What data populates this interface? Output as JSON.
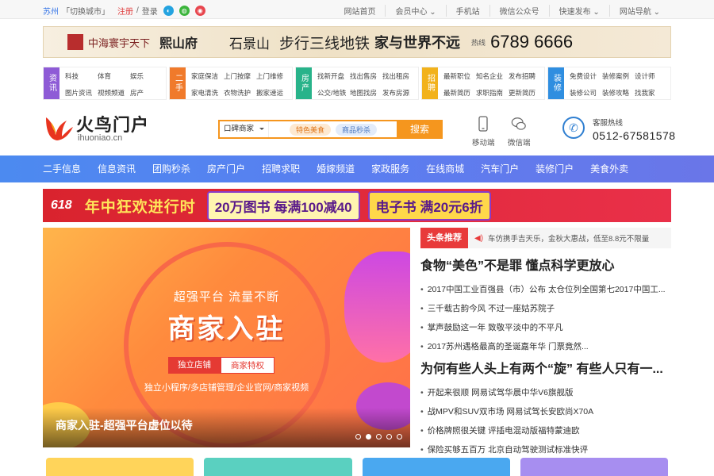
{
  "topbar": {
    "city": "苏州",
    "switch_city": "「切换城市」",
    "register": "注册",
    "sep": "/",
    "login": "登录",
    "links": [
      "网站首页",
      "会员中心 ⌄",
      "手机站",
      "微信公众号",
      "快速发布 ⌄",
      "网站导航 ⌄"
    ]
  },
  "ad_banner": {
    "brand": "中海寰宇天下",
    "project": "熙山府",
    "place": "石景山",
    "slogan_a": "步行三线地铁",
    "slogan_b": "家与世界不远",
    "phone_label": "热线",
    "phone": "6789 6666"
  },
  "categories": [
    {
      "tag": "资讯",
      "color": "#8e5bd6",
      "links": [
        "科技",
        "体育",
        "娱乐",
        "图片资讯",
        "视频频道",
        "房产"
      ]
    },
    {
      "tag": "二手",
      "color": "#f07a2b",
      "links": [
        "家庭保洁",
        "上门按摩",
        "上门维修",
        "家电清洗",
        "衣物洗护",
        "搬家速运"
      ]
    },
    {
      "tag": "房产",
      "color": "#28b38a",
      "links": [
        "找新开盘",
        "找出售房",
        "找出租房",
        "公交/地铁",
        "地图找房",
        "发布房源"
      ]
    },
    {
      "tag": "招聘",
      "color": "#f2b21c",
      "links": [
        "最新职位",
        "知名企业",
        "发布招聘",
        "最新简历",
        "求职指南",
        "更新简历"
      ]
    },
    {
      "tag": "装修",
      "color": "#2f8ee0",
      "links": [
        "免费设计",
        "装修案例",
        "设计师",
        "装修公司",
        "装修攻略",
        "找我家"
      ]
    }
  ],
  "logo": {
    "name": "火鸟门户",
    "domain": "ihuoniao.cn"
  },
  "search": {
    "scope": "口碑商家",
    "chip1": "特色美食",
    "chip2": "商品秒杀",
    "button": "搜索"
  },
  "mobile_label": "移动端",
  "wechat_label": "微信端",
  "hotline": {
    "label": "客服热线",
    "number": "0512-67581578"
  },
  "nav": [
    "二手信息",
    "信息资讯",
    "团购秒杀",
    "房产门户",
    "招聘求职",
    "婚嫁频道",
    "家政服务",
    "在线商城",
    "汽车门户",
    "装修门户",
    "美食外卖"
  ],
  "promo": {
    "tag": "618",
    "title": "年中狂欢进行时",
    "offer1": "20万图书 每满100减40",
    "offer2": "电子书 满20元6折"
  },
  "carousel": {
    "subtitle": "超强平台 流量不断",
    "title": "商家入驻",
    "chip1": "独立店铺",
    "chip2": "商家特权",
    "features": "独立小程序/多店铺管理/企业官网/商家视频",
    "caption": "商家入驻-超强平台虚位以待",
    "active_slide": 1,
    "slide_count": 5
  },
  "news": {
    "label": "头条推荐",
    "ticker": "车仿携手吉天乐，金秋大惠战，低至8.8元不限量",
    "headline1": "食物“美色”不是罪 懂点科学更放心",
    "items1": [
      "2017中国工业百强县（市）公布 太仓位列全国第七2017中国工...",
      "三千载古韵今风 不过一座姑苏院子",
      "掌声鼓励这一年 致敬平淡中的不平凡",
      "2017苏州遇格最高的圣诞嘉年华 门票竟然..."
    ],
    "headline2": "为何有些人头上有两个“旋” 有些人只有一...",
    "items2": [
      "开起来很顺 网易试驾华晨中华V6旗舰版",
      "战MPV和SUV双市场 网易试驾长安欧尚X70A",
      "价格牌照很关键 评插电混动版福特蒙迪欧",
      "保险买够五百万 北京自动驾驶测试标准快评"
    ]
  },
  "card_colors": [
    "#ffd45a",
    "#5ad0c0",
    "#4aa8f0",
    "#a78ef0"
  ]
}
